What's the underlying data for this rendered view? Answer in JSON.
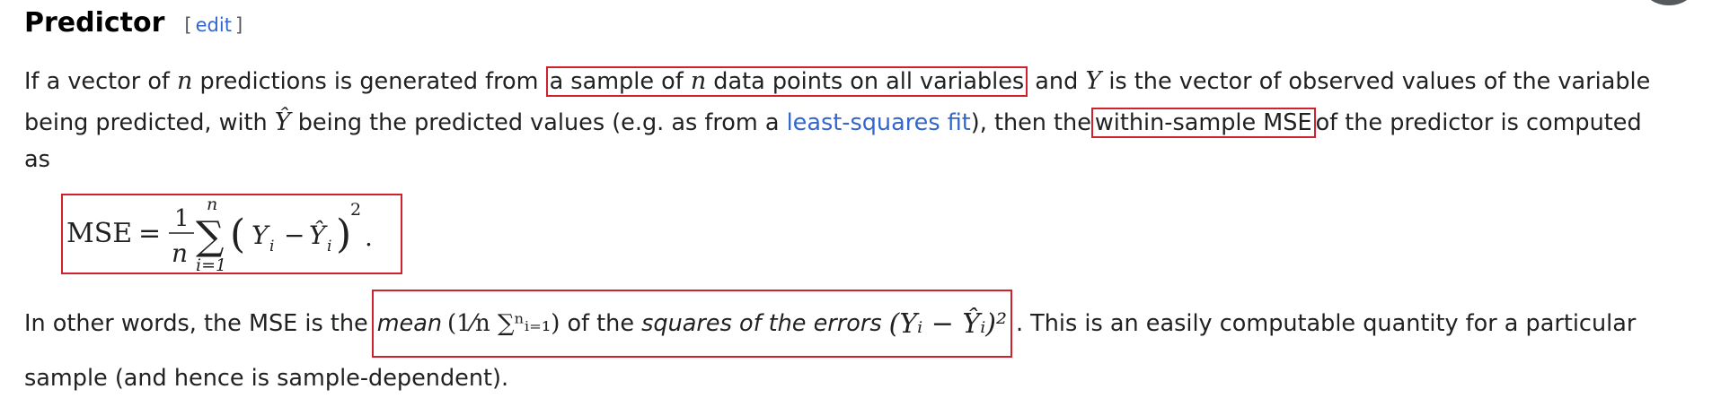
{
  "section": {
    "heading": "Predictor",
    "edit_open": "[",
    "edit_label": "edit",
    "edit_close": "]"
  },
  "para1": {
    "l1_a": "If a vector of ",
    "n": "n",
    "l1_b": " predictions is generated from ",
    "hl1_a": "a sample of ",
    "hl1_b": " data points on all variables",
    "l1_c": " and ",
    "Y": "Y",
    "l1_d": " is the vector of observed values of the variable",
    "l2_a": "being predicted, with ",
    "Yhat": "Ŷ",
    "l2_b": " being the predicted values (e.g. as from a ",
    "link_lsf": "least-squares fit",
    "l2_c": "), then the",
    "hl2": "within-sample MSE",
    "l2_d": "of the predictor is computed",
    "l3": "as"
  },
  "formula": {
    "lhs": "MSE",
    "eq": "=",
    "one": "1",
    "n": "n",
    "sum": "∑",
    "upper": "n",
    "lower": "i=1",
    "lparen": "(",
    "Yi": "Y",
    "sub_i": "i",
    "minus": "−",
    "Yhat_i": "Ŷ",
    "rparen": ")",
    "sq": "2",
    "dot": "."
  },
  "para2": {
    "l1_a": "In other words, the MSE is the",
    "mean": "mean",
    "frac": "(1⁄n ∑ⁿᵢ₌₁)",
    "of_the": " of the ",
    "squares": "squares of the errors",
    "errors_math": "(Yᵢ − Ŷᵢ)²",
    "l1_b": ". This is an easily computable quantity for a particular",
    "l2": "sample (and hence is sample-dependent)."
  }
}
